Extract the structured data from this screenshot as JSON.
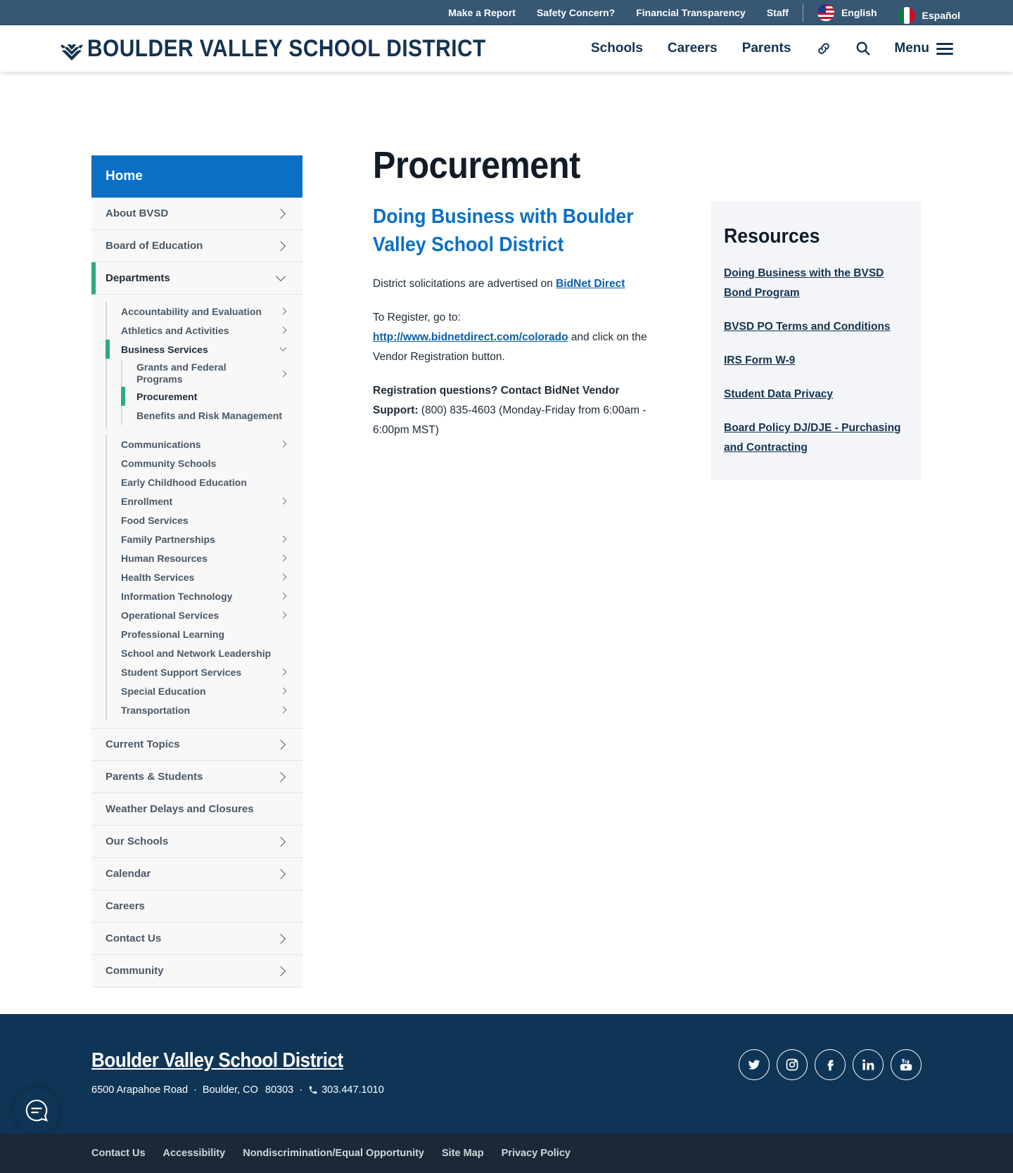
{
  "utility": {
    "links": [
      "Make a Report",
      "Safety Concern?",
      "Financial Transparency",
      "Staff"
    ],
    "lang_english": "English",
    "lang_spanish": "Español"
  },
  "header": {
    "logo_text": "BOULDER VALLEY SCHOOL DISTRICT",
    "nav": [
      "Schools",
      "Careers",
      "Parents"
    ],
    "menu_label": "Menu"
  },
  "sidebar": {
    "home": "Home",
    "top_items": [
      "About BVSD",
      "Board of Education"
    ],
    "departments": "Departments",
    "dept_items_a": [
      "Accountability and Evaluation",
      "Athletics and Activities"
    ],
    "business_services": "Business Services",
    "business_children": [
      "Grants and Federal Programs",
      "Procurement",
      "Benefits and Risk Management"
    ],
    "dept_items_b": [
      "Communications",
      "Community Schools",
      "Early Childhood Education",
      "Enrollment",
      "Food Services",
      "Family Partnerships",
      "Human Resources",
      "Health Services",
      "Information Technology",
      "Operational Services",
      "Professional Learning",
      "School and Network Leadership",
      "Student Support Services",
      "Special Education",
      "Transportation"
    ],
    "bottom_items": [
      "Current Topics",
      "Parents & Students",
      "Weather Delays and Closures",
      "Our Schools",
      "Calendar",
      "Careers",
      "Contact Us",
      "Community"
    ]
  },
  "content": {
    "title": "Procurement",
    "subtitle": "Doing Business with Boulder Valley School District",
    "p1_text": "District solicitations are advertised on ",
    "p1_link": "BidNet Direct",
    "p2_text": "To Register, go to:",
    "p2_link": "http://www.bidnetdirect.com/colorado",
    "p2_after": " and click on the Vendor Registration button.",
    "p3_bold": "Registration questions? Contact BidNet Vendor Support:",
    "p3_text": " (800) 835-4603 (Monday-Friday from 6:00am - 6:00pm MST)"
  },
  "resources": {
    "title": "Resources",
    "links": [
      "Doing Business with the BVSD Bond Program",
      "BVSD PO Terms and Conditions",
      "IRS Form W-9",
      "Student Data Privacy",
      "Board Policy DJ/DJE - Purchasing and Contracting"
    ]
  },
  "footer": {
    "name": "Boulder Valley School District",
    "address": "6500 Arapahoe Road",
    "city": "Boulder, CO",
    "zip": "80303",
    "phone": "303.447.1010",
    "dot": "·",
    "bottom_links": [
      "Contact Us",
      "Accessibility",
      "Nondiscrimination/Equal Opportunity",
      "Site Map",
      "Privacy Policy"
    ]
  },
  "colors": {
    "utility_bar": "#375772",
    "brand_navy": "#14334f",
    "accent_blue": "#0b6fc6",
    "active_green": "#2bab7c",
    "footer": "#0f3556"
  }
}
